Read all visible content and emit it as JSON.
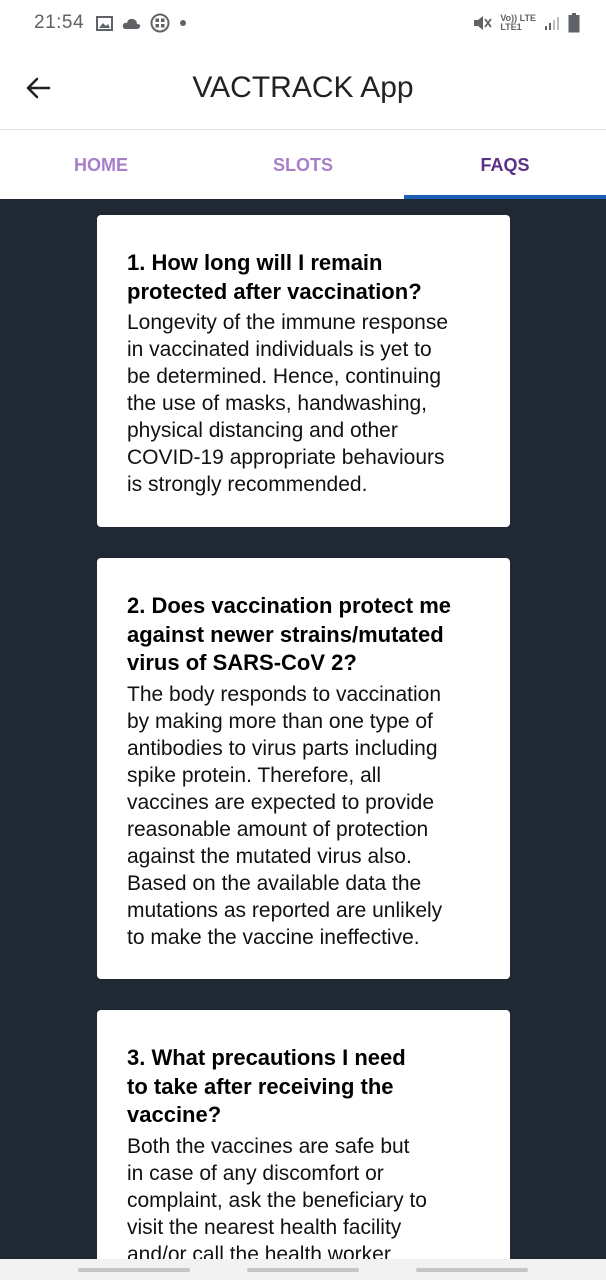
{
  "status_bar": {
    "time": "21:54",
    "icons_left": [
      "image-icon",
      "cloud-icon",
      "grid-app-icon",
      "dot-icon"
    ],
    "network_top": "Vo)) LTE",
    "network_bottom": "LTE1",
    "icons_right": [
      "mute-icon",
      "signal-icon",
      "battery-icon"
    ]
  },
  "app_bar": {
    "title": "VACTRACK App"
  },
  "tabs": [
    {
      "label": "HOME",
      "active": false
    },
    {
      "label": "SLOTS",
      "active": false
    },
    {
      "label": "FAQS",
      "active": true
    }
  ],
  "faqs": [
    {
      "question": "1. How long will I remain\nprotected after vaccination?",
      "answer": "Longevity of the immune response\nin vaccinated individuals is yet to\nbe determined. Hence, continuing\nthe use of masks, handwashing,\nphysical distancing and other\nCOVID-19 appropriate behaviours\nis strongly recommended."
    },
    {
      "question": "2. Does vaccination protect me\nagainst newer strains/mutated\nvirus of SARS-CoV 2?",
      "answer": "The body responds to vaccination\nby making more than one type of\nantibodies to virus parts including\nspike protein. Therefore, all\nvaccines are expected to provide\nreasonable amount of protection\nagainst the mutated virus also.\nBased on the available data the\nmutations as reported are unlikely\nto make the vaccine ineffective."
    },
    {
      "question": "3. What precautions I need\nto take after receiving the\nvaccine?",
      "answer": "Both the vaccines are safe but\nin case of any discomfort or\ncomplaint, ask the beneficiary to\nvisit the nearest health facility\nand/or call the health worker"
    }
  ],
  "colors": {
    "tab_inactive": "#a77fc9",
    "tab_active": "#5a2f86",
    "tab_indicator": "#1a5fb4",
    "content_bg": "#1f2833",
    "card_bg": "#ffffff"
  }
}
